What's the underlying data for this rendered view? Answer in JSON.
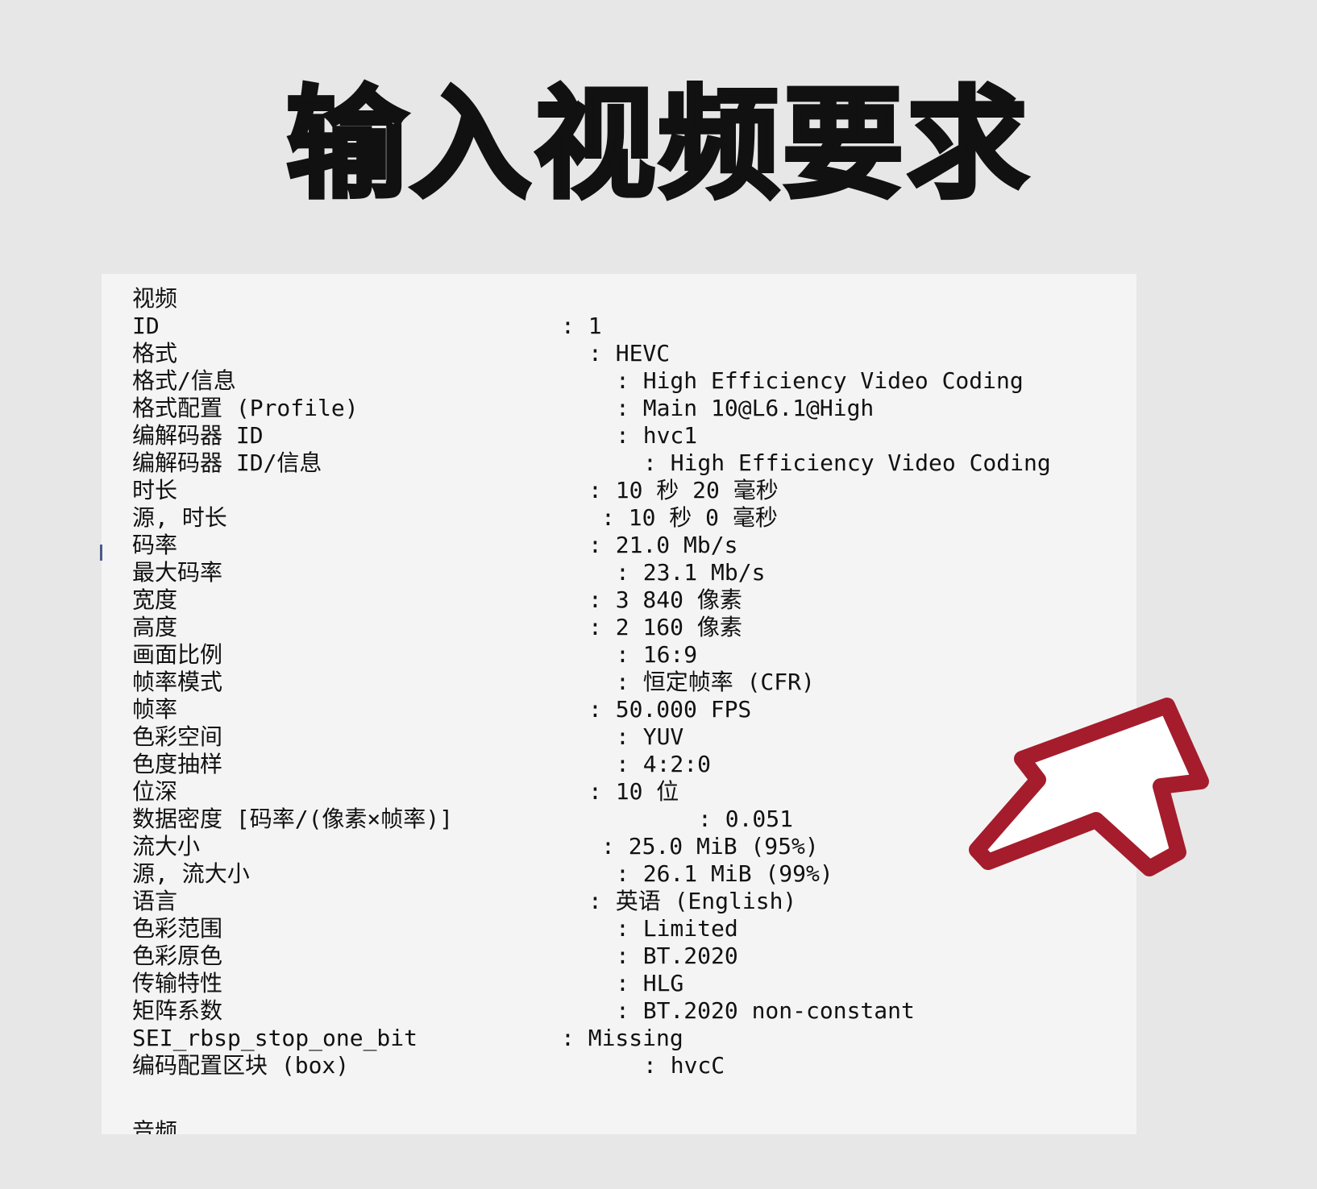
{
  "headline": "输入视频要求",
  "video_section_title": "视频",
  "audio_section_title": "音频",
  "accent_color": "#a51c2c",
  "rows": [
    {
      "key": "ID",
      "value": ": 1"
    },
    {
      "key": "格式",
      "value": ": HEVC"
    },
    {
      "key": "格式/信息",
      "value": ": High Efficiency Video Coding"
    },
    {
      "key": "格式配置 (Profile)",
      "value": ": Main 10@L6.1@High"
    },
    {
      "key": "编解码器 ID",
      "value": ": hvc1"
    },
    {
      "key": "编解码器 ID/信息",
      "value": ": High Efficiency Video Coding"
    },
    {
      "key": "时长",
      "value": ": 10 秒 20 毫秒"
    },
    {
      "key": "源, 时长",
      "value": ": 10 秒 0 毫秒"
    },
    {
      "key": "码率",
      "value": ": 21.0 Mb/s"
    },
    {
      "key": "最大码率",
      "value": ": 23.1 Mb/s"
    },
    {
      "key": "宽度",
      "value": ": 3 840 像素"
    },
    {
      "key": "高度",
      "value": ": 2 160 像素"
    },
    {
      "key": "画面比例",
      "value": ": 16:9"
    },
    {
      "key": "帧率模式",
      "value": ": 恒定帧率 (CFR)"
    },
    {
      "key": "帧率",
      "value": ": 50.000 FPS"
    },
    {
      "key": "色彩空间",
      "value": ": YUV"
    },
    {
      "key": "色度抽样",
      "value": ": 4:2:0"
    },
    {
      "key": "位深",
      "value": ": 10 位"
    },
    {
      "key": "数据密度 [码率/(像素×帧率)]",
      "value": ": 0.051"
    },
    {
      "key": "流大小",
      "value": ": 25.0 MiB (95%)"
    },
    {
      "key": "源, 流大小",
      "value": ": 26.1 MiB (99%)"
    },
    {
      "key": "语言",
      "value": ": 英语 (English)"
    },
    {
      "key": "色彩范围",
      "value": ": Limited"
    },
    {
      "key": "色彩原色",
      "value": ": BT.2020"
    },
    {
      "key": "传输特性",
      "value": ": HLG"
    },
    {
      "key": "矩阵系数",
      "value": ": BT.2020 non-constant"
    },
    {
      "key": "SEI_rbsp_stop_one_bit",
      "value": ": Missing"
    },
    {
      "key": "编码配置区块 (box)",
      "value": ": hvcC"
    }
  ]
}
